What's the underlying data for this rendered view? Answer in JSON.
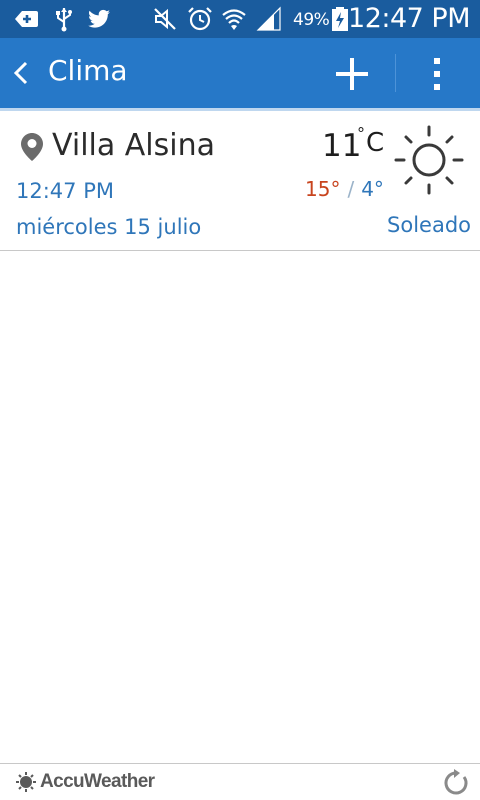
{
  "status_bar": {
    "battery_percent": "49%",
    "time": "12:47 PM",
    "icons": [
      "notification-add-icon",
      "usb-icon",
      "twitter-icon",
      "mute-icon",
      "alarm-icon",
      "wifi-icon",
      "signal-icon",
      "battery-charging-icon"
    ]
  },
  "app_bar": {
    "title": "Clima",
    "back_icon": "chevron-left-icon",
    "add_icon": "plus-icon",
    "menu_icon": "more-vertical-icon"
  },
  "location": {
    "city": "Villa Alsina",
    "time": "12:47 PM",
    "date": "miércoles 15 julio",
    "temperature": "11",
    "unit": "C",
    "high": "15°",
    "low": "4°",
    "separator": "/",
    "condition": "Soleado",
    "condition_icon": "sun-icon"
  },
  "footer": {
    "brand": "AccuWeather",
    "refresh_icon": "refresh-icon"
  },
  "colors": {
    "status_bar": "#1a5c9e",
    "app_bar": "#2678c8",
    "accent_text": "#2f76b9",
    "high_temp": "#c8441e"
  }
}
